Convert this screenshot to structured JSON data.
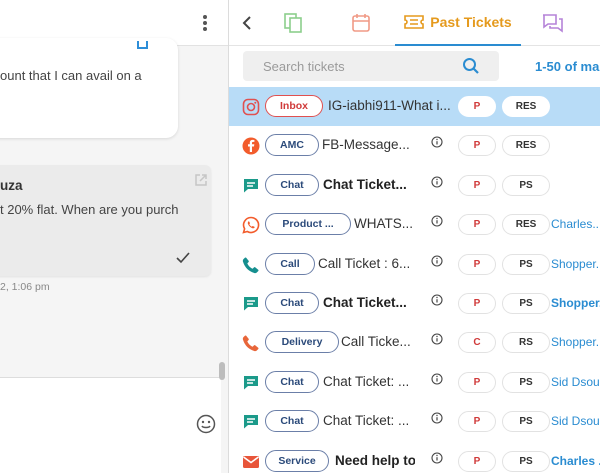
{
  "chat": {
    "message_1": "ount that I can avail on a",
    "agent_name": "uza",
    "message_2": "t 20% flat. When are you purch",
    "timestamp": "2, 1:06 pm"
  },
  "panel": {
    "tabs": {
      "active_label": "Past Tickets"
    },
    "search": {
      "placeholder": "Search tickets"
    },
    "pagination": "1-50 of ma"
  },
  "tickets": [
    {
      "channel": "instagram-icon",
      "tag": "Inbox",
      "title": "IG-iabhi911-What i...",
      "priority": "P",
      "status": "RES",
      "assignee": ""
    },
    {
      "channel": "facebook-icon",
      "tag": "AMC",
      "title": "FB-Message...",
      "priority": "P",
      "status": "RES",
      "assignee": ""
    },
    {
      "channel": "chat-icon",
      "tag": "Chat",
      "title": "Chat Ticket...",
      "priority": "P",
      "status": "PS",
      "assignee": ""
    },
    {
      "channel": "whatsapp-icon",
      "tag": "Product ...",
      "title": "WHATS...",
      "priority": "P",
      "status": "RES",
      "assignee": "Charles..."
    },
    {
      "channel": "phone-icon",
      "tag": "Call",
      "title": "Call Ticket : 6...",
      "priority": "P",
      "status": "PS",
      "assignee": "Shopper..."
    },
    {
      "channel": "chat-icon",
      "tag": "Chat",
      "title": "Chat Ticket...",
      "priority": "P",
      "status": "PS",
      "assignee": "Shopper..."
    },
    {
      "channel": "phone-icon",
      "tag": "Delivery",
      "title": "Call Ticke...",
      "priority": "C",
      "status": "RS",
      "assignee": "Shopper..."
    },
    {
      "channel": "chat-icon",
      "tag": "Chat",
      "title": "Chat Ticket: ...",
      "priority": "P",
      "status": "PS",
      "assignee": "Sid Dsou..."
    },
    {
      "channel": "chat-icon",
      "tag": "Chat",
      "title": "Chat Ticket: ...",
      "priority": "P",
      "status": "PS",
      "assignee": "Sid Dsou..."
    },
    {
      "channel": "email-icon",
      "tag": "Service",
      "title": "Need help to",
      "priority": "P",
      "status": "PS",
      "assignee": "Charles ."
    }
  ],
  "colors": {
    "accent": "#2a8cd1",
    "active_tab": "#e59a1d",
    "selected_row": "#b8dcf7",
    "priority": "#d03a3a",
    "chat_icon": "#1b9a8a",
    "phone_teal": "#168f8f",
    "phone_orange": "#e8663a",
    "instagram": "#e05050",
    "facebook": "#f25c2c",
    "whatsapp": "#f25c2c",
    "email": "#e8553a"
  }
}
